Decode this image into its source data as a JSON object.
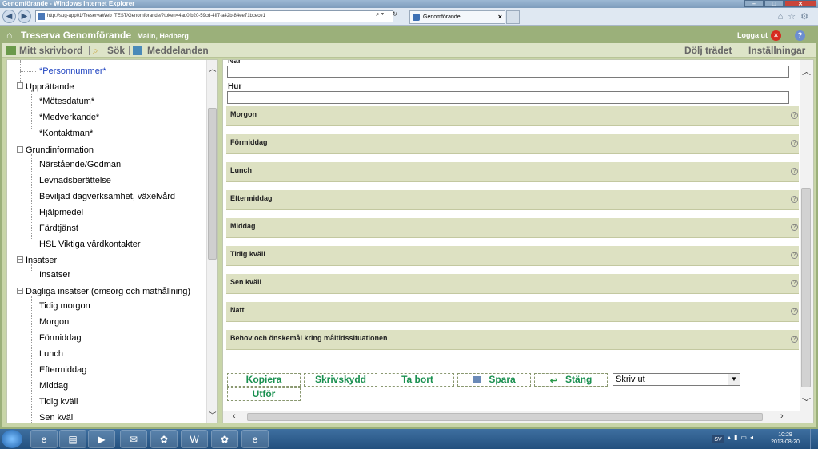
{
  "window": {
    "title": "Genomförande - Windows Internet Explorer"
  },
  "browser": {
    "address": "http://sug-app01/TreservaWeb_TEST/Genomforande/?token=4ad0fb20-59cd-4ff7-a42b-84ee71bcece1",
    "tab_title": "Genomförande",
    "tab_close": "×"
  },
  "app": {
    "title": "Treserva Genomförande",
    "user": "Malin, Hedberg",
    "logout_label": "Logga ut",
    "logout_x": "×",
    "help_label": "?"
  },
  "menu": {
    "my_desk": "Mitt skrivbord",
    "search": "Sök",
    "messages": "Meddelanden",
    "hide_tree": "Dölj trädet",
    "settings": "Inställningar"
  },
  "tree": {
    "personnummer": "*Personnummer*",
    "upprattande": {
      "label": "Upprättande",
      "children": [
        "*Mötesdatum*",
        "*Medverkande*",
        "*Kontaktman*"
      ]
    },
    "grundinformation": {
      "label": "Grundinformation",
      "children": [
        "Närstående/Godman",
        "Levnadsberättelse",
        "Beviljad dagverksamhet, växelvård",
        "Hjälpmedel",
        "Färdtjänst",
        "HSL Viktiga vårdkontakter"
      ]
    },
    "insatser": {
      "label": "Insatser",
      "children": [
        "Insatser"
      ]
    },
    "dagliga": {
      "label": "Dagliga insatser (omsorg och mathållning)",
      "children": [
        "Tidig morgon",
        "Morgon",
        "Förmiddag",
        "Lunch",
        "Eftermiddag",
        "Middag",
        "Tidig kväll",
        "Sen kväll"
      ]
    },
    "toggle_symbol": "−"
  },
  "form": {
    "nar_label": "När",
    "hur_label": "Hur",
    "sections": [
      "Morgon",
      "Förmiddag",
      "Lunch",
      "Eftermiddag",
      "Middag",
      "Tidig kväll",
      "Sen kväll",
      "Natt",
      "Behov och önskemål kring måltidssituationen"
    ],
    "section_help": "?"
  },
  "actions": {
    "kopiera": "Kopiera",
    "skrivskydd": "Skrivskydd",
    "ta_bort": "Ta bort",
    "spara": "Spara",
    "stang": "Stäng",
    "utfor": "Utför",
    "print_selected": "Skriv ut"
  },
  "taskbar": {
    "lang": "SV",
    "time": "10:29",
    "date": "2013-08-20"
  },
  "colors": {
    "app_header": "#9bb07a",
    "section_bg": "#dde1c2",
    "action_text": "#1a9050",
    "tree_link": "#1a3fbf"
  }
}
